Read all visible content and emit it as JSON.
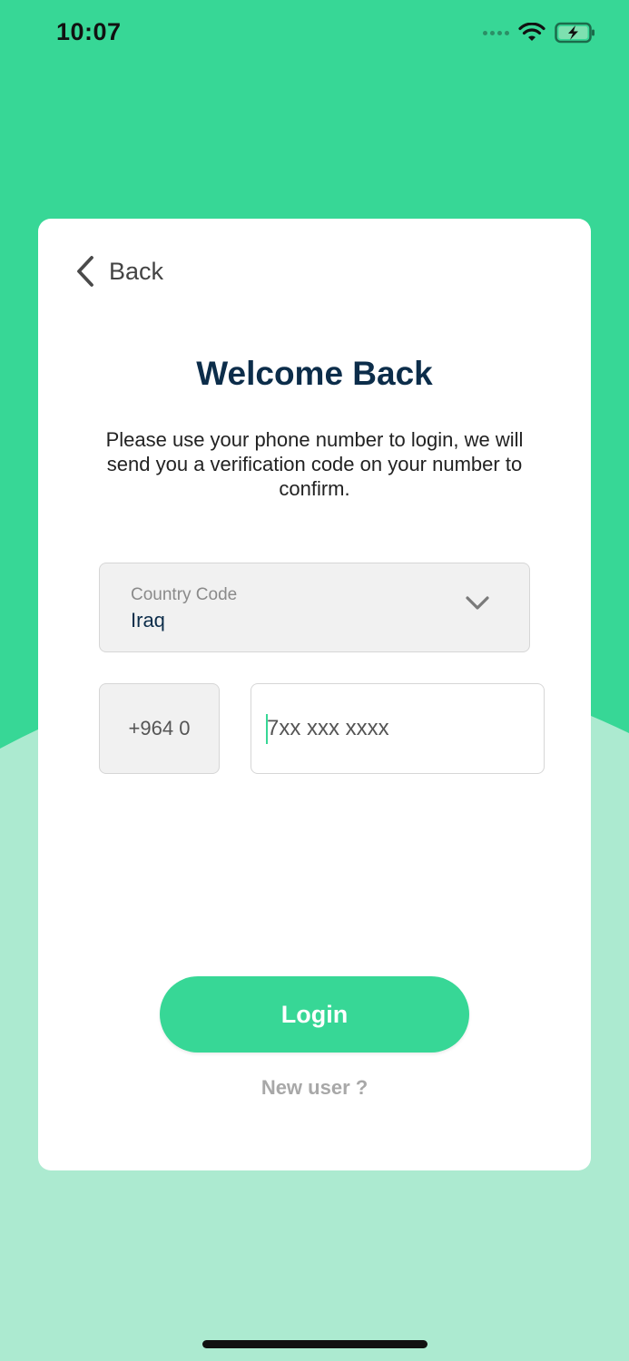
{
  "status_bar": {
    "time": "10:07",
    "icons": [
      "signal-icon",
      "wifi-icon",
      "battery-charging-icon"
    ]
  },
  "colors": {
    "brand_green": "#37d796",
    "light_green": "#acead0",
    "title_navy": "#0c2d4a",
    "field_gray": "#f1f1f1"
  },
  "header": {
    "back_label": "Back",
    "back_icon": "chevron-left-icon"
  },
  "main": {
    "title": "Welcome Back",
    "subtitle": "Please use your phone number to login, we will send you a verification code on your number to confirm."
  },
  "form": {
    "country_label": "Country Code",
    "country_value": "Iraq",
    "dropdown_icon": "chevron-down-icon",
    "phone_prefix": "+964 0",
    "phone_placeholder": "7xx xxx xxxx",
    "phone_value": ""
  },
  "actions": {
    "login_label": "Login",
    "new_user_label": "New user ?"
  }
}
